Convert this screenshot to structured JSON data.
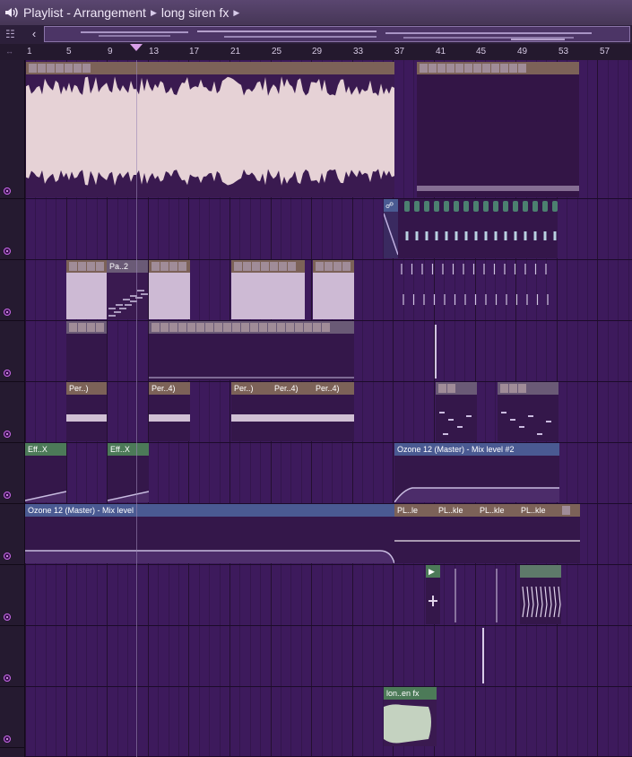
{
  "window": {
    "title_parts": [
      "Playlist - Arrangement",
      "long siren fx"
    ],
    "separator_icon": "triangle-right-icon"
  },
  "ruler": {
    "bars": [
      "1",
      "5",
      "9",
      "13",
      "17",
      "21",
      "25",
      "29",
      "33",
      "37",
      "41",
      "45",
      "49",
      "53",
      "57"
    ],
    "playhead_bar": "11"
  },
  "clips": {
    "pattern_label": "Pa..2",
    "per_1": "Per..)",
    "per_2": "Per..4)",
    "per_3": "Per..)",
    "per_4": "Per..4)",
    "per_5": "Per..4)",
    "eff_1": "Eff..X",
    "eff_2": "Eff..X",
    "ozone_mix2": "Ozone 12 (Master) - Mix level #2",
    "ozone_mix": "Ozone 12 (Master) - Mix level",
    "pl_1": "PL..le",
    "pl_2": "PL..kle",
    "pl_3": "PL..kle",
    "pl_4": "PL..kle",
    "long_siren": "lon..en fx"
  },
  "colors": {
    "background": "#3d1a5c",
    "audio_header": "#7c6258",
    "automation_header": "#4a5a92",
    "green_header": "#4c7a58",
    "waveform": "#e6d2d6"
  }
}
